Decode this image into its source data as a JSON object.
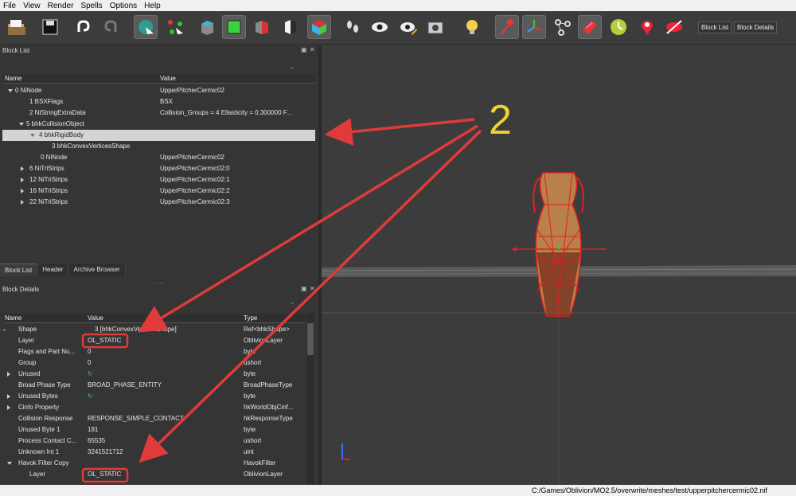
{
  "menu": [
    "File",
    "View",
    "Render",
    "Spells",
    "Options",
    "Help"
  ],
  "toolbar": {
    "block_list_btn": "Block List",
    "block_details_btn": "Block Details"
  },
  "block_list": {
    "title": "Block List",
    "columns": [
      "Name",
      "Value"
    ],
    "rows": [
      {
        "name": "0 NiNode",
        "value": "UpperPitcherCermic02"
      },
      {
        "name": "1 BSXFlags",
        "value": "BSX"
      },
      {
        "name": "2 NiStringExtraData",
        "value": "Collision_Groups = 4  Ellasticity = 0.300000  F..."
      },
      {
        "name": "5 bhkCollisionObject",
        "value": ""
      },
      {
        "name": "4 bhkRigidBody",
        "value": ""
      },
      {
        "name": "3 bhkConvexVerticesShape",
        "value": ""
      },
      {
        "name": "0 NiNode",
        "value": "UpperPitcherCermic02"
      },
      {
        "name": "6 NiTriStrips",
        "value": "UpperPitcherCermic02:0"
      },
      {
        "name": "12 NiTriStrips",
        "value": "UpperPitcherCermic02:1"
      },
      {
        "name": "16 NiTriStrips",
        "value": "UpperPitcherCermic02:2"
      },
      {
        "name": "22 NiTriStrips",
        "value": "UpperPitcherCermic02:3"
      }
    ]
  },
  "tabs": [
    "Block List",
    "Header",
    "Archive Browser"
  ],
  "block_details": {
    "title": "Block Details",
    "columns": [
      "Name",
      "Value",
      "Type"
    ],
    "rows": [
      {
        "name": "Shape",
        "value": "3 [bhkConvexVerticesShape]",
        "type": "Ref<bhkShape>"
      },
      {
        "name": "Layer",
        "value": "OL_STATIC",
        "type": "OblivionLayer"
      },
      {
        "name": "Flags and Part Nu...",
        "value": "0",
        "type": "byte"
      },
      {
        "name": "Group",
        "value": "0",
        "type": "ushort"
      },
      {
        "name": "Unused",
        "value": "",
        "type": "byte"
      },
      {
        "name": "Broad Phase Type",
        "value": "BROAD_PHASE_ENTITY",
        "type": "BroadPhaseType"
      },
      {
        "name": "Unused Bytes",
        "value": "",
        "type": "byte"
      },
      {
        "name": "Cinfo Property",
        "value": "",
        "type": "hkWorldObjCinf..."
      },
      {
        "name": "Collision Response",
        "value": "RESPONSE_SIMPLE_CONTACT",
        "type": "hkResponseType"
      },
      {
        "name": "Unused Byte 1",
        "value": "181",
        "type": "byte"
      },
      {
        "name": "Process Contact C...",
        "value": "65535",
        "type": "ushort"
      },
      {
        "name": "Unknown Int 1",
        "value": "3241521712",
        "type": "uint"
      },
      {
        "name": "Havok Filter Copy",
        "value": "",
        "type": "HavokFilter"
      },
      {
        "name": "Layer",
        "value": "OL_STATIC",
        "type": "OblivionLayer"
      }
    ]
  },
  "annotation": {
    "label": "2",
    "color": "#e03a3a",
    "label_color": "#f2d22e"
  },
  "status": {
    "path": "C:/Games/Oblivion/MO2.5/overwrite/meshes/test/upperpitchercermic02.nif"
  }
}
